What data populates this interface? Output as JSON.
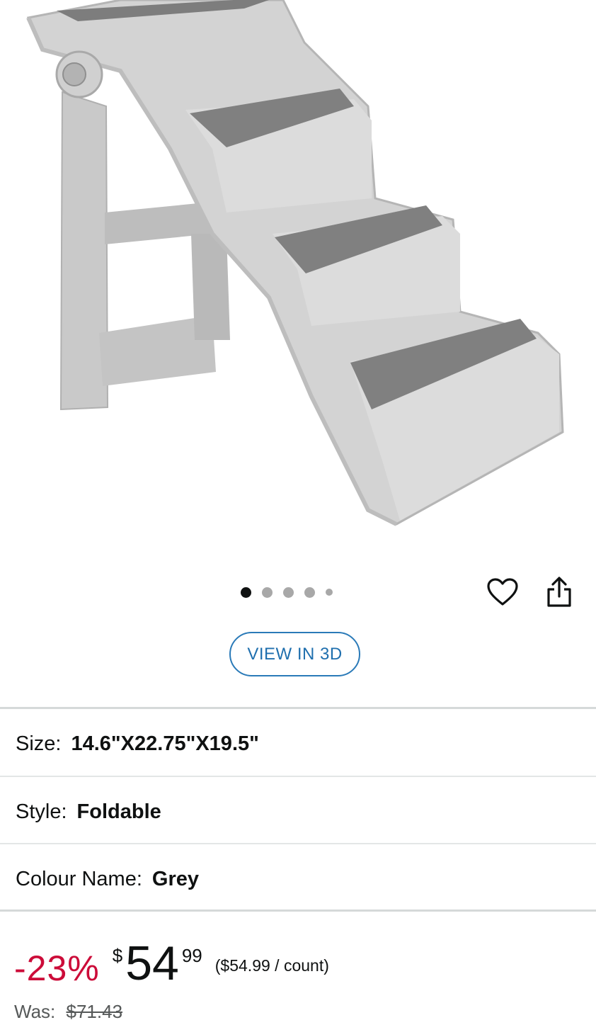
{
  "gallery": {
    "image_description": "grey foldable pet stairs",
    "dots": [
      {
        "active": true
      },
      {
        "active": false
      },
      {
        "active": false
      },
      {
        "active": false
      },
      {
        "active": false,
        "small": true
      }
    ],
    "wishlist_icon": "heart-outline-icon",
    "share_icon": "share-icon"
  },
  "view_3d_label": "VIEW IN 3D",
  "variations": [
    {
      "label": "Size:",
      "value": "14.6\"X22.75\"X19.5\""
    },
    {
      "label": "Style:",
      "value": "Foldable"
    },
    {
      "label": "Colour Name:",
      "value": "Grey"
    }
  ],
  "price": {
    "discount": "-23%",
    "currency": "$",
    "whole": "54",
    "fraction": "99",
    "per_unit": "($54.99 / count)",
    "was_label": "Was:",
    "was_price": "$71.43"
  },
  "colors": {
    "discount": "#cc0c39",
    "view3d_border": "#2a7ab8",
    "view3d_text": "#1f6fae"
  }
}
